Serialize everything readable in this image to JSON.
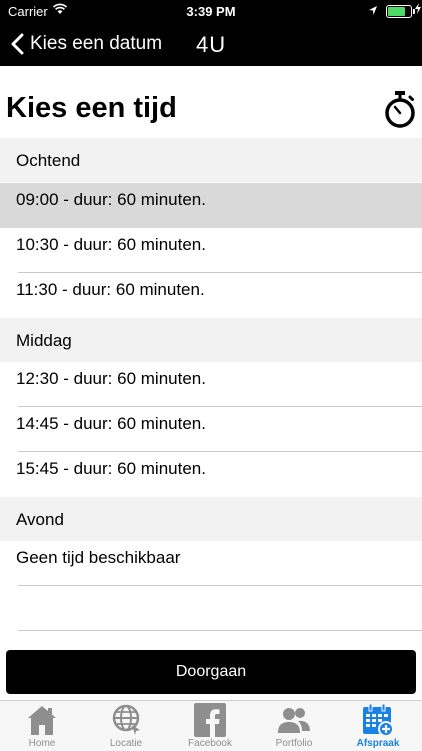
{
  "status": {
    "carrier": "Carrier",
    "time": "3:39 PM"
  },
  "nav": {
    "back_label": "Kies een datum",
    "title": "4U"
  },
  "page": {
    "heading": "Kies een tijd"
  },
  "sections": [
    {
      "title": "Ochtend",
      "slots": [
        "09:00 - duur: 60 minuten.",
        "10:30 - duur: 60 minuten.",
        "11:30 - duur: 60 minuten."
      ]
    },
    {
      "title": "Middag",
      "slots": [
        "12:30 - duur: 60 minuten.",
        "14:45 - duur: 60 minuten.",
        "15:45 - duur: 60 minuten."
      ]
    },
    {
      "title": "Avond",
      "slots": [
        "Geen tijd beschikbaar"
      ]
    }
  ],
  "selected_slot": "09:00 - duur: 60 minuten.",
  "continue_button": "Doorgaan",
  "tabs": [
    {
      "label": "Home",
      "icon": "home-icon"
    },
    {
      "label": "Locatie",
      "icon": "globe-icon"
    },
    {
      "label": "Facebook",
      "icon": "facebook-icon"
    },
    {
      "label": "Portfolio",
      "icon": "people-icon"
    },
    {
      "label": "Afspraak",
      "icon": "calendar-add-icon"
    }
  ],
  "active_tab": "Afspraak",
  "colors": {
    "bar": "#000000",
    "section_bg": "#f2f2f2",
    "selected_row": "#d9d9d9",
    "active_tab": "#1a82e2",
    "inactive_tab": "#8e8e8e",
    "battery": "#4cd964"
  }
}
